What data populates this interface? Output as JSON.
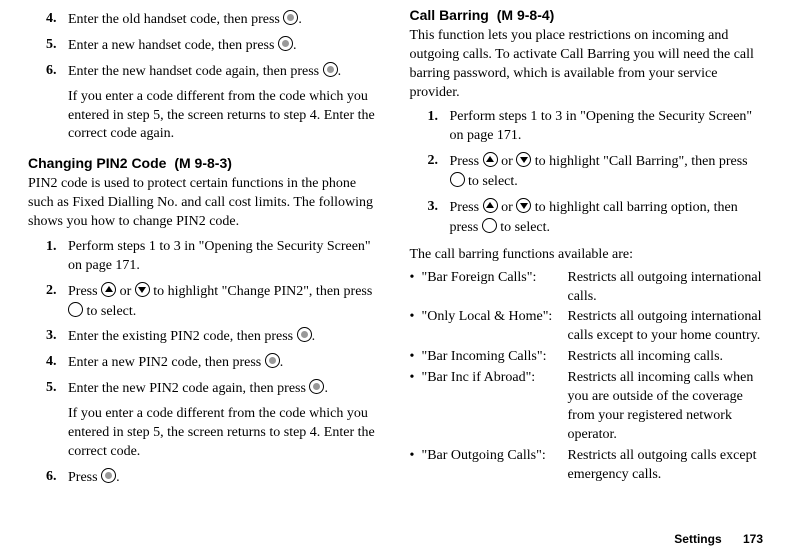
{
  "left": {
    "steps_top": [
      {
        "n": "4.",
        "t": "Enter the old handset code, then press "
      },
      {
        "n": "5.",
        "t": "Enter a new handset code, then press "
      },
      {
        "n": "6.",
        "t": "Enter the new handset code again, then press "
      }
    ],
    "note_top": "If you enter a code different from the code which you entered in step 5, the screen returns to step 4. Enter the correct code again.",
    "heading": "Changing PIN2 Code",
    "menucode": "(M 9-8-3)",
    "intro": "PIN2 code is used to protect certain functions in the phone such as Fixed Dialling No. and call cost limits. The following shows you how to change PIN2 code.",
    "steps_mid": [
      {
        "n": "1.",
        "t": "Perform steps 1 to 3 in \"Opening the Security Screen\" on page 171."
      },
      {
        "n": "2.",
        "t_before": "Press ",
        "t_mid": " or ",
        "t_after": " to highlight \"Change PIN2\", then press ",
        "t_end": " to select."
      },
      {
        "n": "3.",
        "t": "Enter the existing PIN2 code, then press "
      },
      {
        "n": "4.",
        "t": "Enter a new PIN2 code, then press "
      },
      {
        "n": "5.",
        "t": "Enter the new PIN2 code again, then press "
      }
    ],
    "note_mid": "If you enter a code different from the code which you entered in step 5, the screen returns to step 4. Enter the correct code.",
    "step6": {
      "n": "6.",
      "t": "Press "
    }
  },
  "right": {
    "heading": "Call Barring",
    "menucode": "(M 9-8-4)",
    "intro": "This function lets you place restrictions on incoming and outgoing calls. To activate Call Barring you will need the call barring password, which is available from your service provider.",
    "steps": [
      {
        "n": "1.",
        "t": "Perform steps 1 to 3 in \"Opening the Security Screen\" on page 171."
      },
      {
        "n": "2.",
        "t_before": "Press ",
        "t_mid": " or ",
        "t_after": " to highlight \"Call Barring\", then press ",
        "t_end": " to select."
      },
      {
        "n": "3.",
        "t_before": "Press ",
        "t_mid": " or ",
        "t_after": " to highlight call barring option, then press ",
        "t_end": " to select."
      }
    ],
    "listintro": "The call barring functions available are:",
    "items": [
      {
        "label": "\"Bar Foreign Calls\":",
        "desc": "Restricts all outgoing international calls."
      },
      {
        "label": "\"Only Local & Home\":",
        "desc": "Restricts all outgoing international calls except to your home country."
      },
      {
        "label": "\"Bar Incoming Calls\":",
        "desc": "Restricts all incoming calls."
      },
      {
        "label": "\"Bar Inc if Abroad\":",
        "desc": "Restricts all incoming calls when you are outside of the coverage from your registered network operator."
      },
      {
        "label": "\"Bar Outgoing Calls\":",
        "desc": "Restricts all outgoing calls except emergency calls."
      }
    ]
  },
  "footer": {
    "section": "Settings",
    "page": "173"
  }
}
